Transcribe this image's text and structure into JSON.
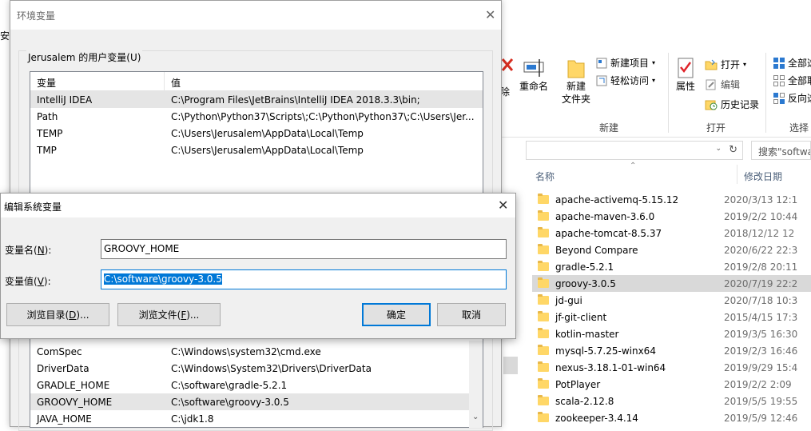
{
  "explorer": {
    "left_edge_fragment": "安全",
    "ribbon": {
      "delete_fragment": "除",
      "rename": "重命名",
      "new_folder": "新建\n文件夹",
      "new_item": "新建项目",
      "easy_access": "轻松访问",
      "new_group": "新建",
      "properties": "属性",
      "open": "打开",
      "edit": "编辑",
      "history": "历史记录",
      "open_group": "打开",
      "select_all": "全部选",
      "select_none": "全部取",
      "invert": "反向选",
      "select_group": "选择"
    },
    "search_placeholder": "搜索\"software\"",
    "columns": {
      "name": "名称",
      "date": "修改日期"
    },
    "files": [
      {
        "name": "apache-activemq-5.15.12",
        "date": "2020/3/13 12:1"
      },
      {
        "name": "apache-maven-3.6.0",
        "date": "2019/2/2 10:44"
      },
      {
        "name": "apache-tomcat-8.5.37",
        "date": "2018/12/12 12"
      },
      {
        "name": "Beyond Compare",
        "date": "2020/6/22 22:3"
      },
      {
        "name": "gradle-5.2.1",
        "date": "2019/2/8 20:11"
      },
      {
        "name": "groovy-3.0.5",
        "date": "2020/7/19 22:2"
      },
      {
        "name": "jd-gui",
        "date": "2020/7/18 10:3"
      },
      {
        "name": "jf-git-client",
        "date": "2015/4/15 17:3"
      },
      {
        "name": "kotlin-master",
        "date": "2019/3/5 16:30"
      },
      {
        "name": "mysql-5.7.25-winx64",
        "date": "2019/2/3 16:46"
      },
      {
        "name": "nexus-3.18.1-01-win64",
        "date": "2019/9/29 15:4"
      },
      {
        "name": "PotPlayer",
        "date": "2019/2/2 2:09"
      },
      {
        "name": "scala-2.12.8",
        "date": "2019/5/5 19:55"
      },
      {
        "name": "zookeeper-3.4.14",
        "date": "2019/5/9 12:46"
      }
    ]
  },
  "env_dialog": {
    "title": "环境变量",
    "user_group_title": "Jerusalem 的用户变量(U)",
    "col_var": "变量",
    "col_val": "值",
    "user_vars": [
      {
        "name": "IntelliJ IDEA",
        "value": "C:\\Program Files\\JetBrains\\IntelliJ IDEA 2018.3.3\\bin;"
      },
      {
        "name": "Path",
        "value": "C:\\Python\\Python37\\Scripts\\;C:\\Python\\Python37\\;C:\\Users\\Jer..."
      },
      {
        "name": "TEMP",
        "value": "C:\\Users\\Jerusalem\\AppData\\Local\\Temp"
      },
      {
        "name": "TMP",
        "value": "C:\\Users\\Jerusalem\\AppData\\Local\\Temp"
      }
    ],
    "system_vars": [
      {
        "name": "ComSpec",
        "value": "C:\\Windows\\system32\\cmd.exe"
      },
      {
        "name": "DriverData",
        "value": "C:\\Windows\\System32\\Drivers\\DriverData"
      },
      {
        "name": "GRADLE_HOME",
        "value": "C:\\software\\gradle-5.2.1"
      },
      {
        "name": "GROOVY_HOME",
        "value": "C:\\software\\groovy-3.0.5"
      },
      {
        "name": "JAVA_HOME",
        "value": "C:\\jdk1.8"
      }
    ]
  },
  "edit_dialog": {
    "title": "编辑系统变量",
    "name_label": "变量名(",
    "name_key": "N",
    "name_label_end": "):",
    "name_value": "GROOVY_HOME",
    "value_label": "变量值(",
    "value_key": "V",
    "value_label_end": "):",
    "value_value": "C:\\software\\groovy-3.0.5",
    "browse_dir": "浏览目录(",
    "browse_dir_key": "D",
    "browse_dir_end": ")...",
    "browse_file": "浏览文件(",
    "browse_file_key": "F",
    "browse_file_end": ")...",
    "ok": "确定",
    "cancel": "取消"
  }
}
